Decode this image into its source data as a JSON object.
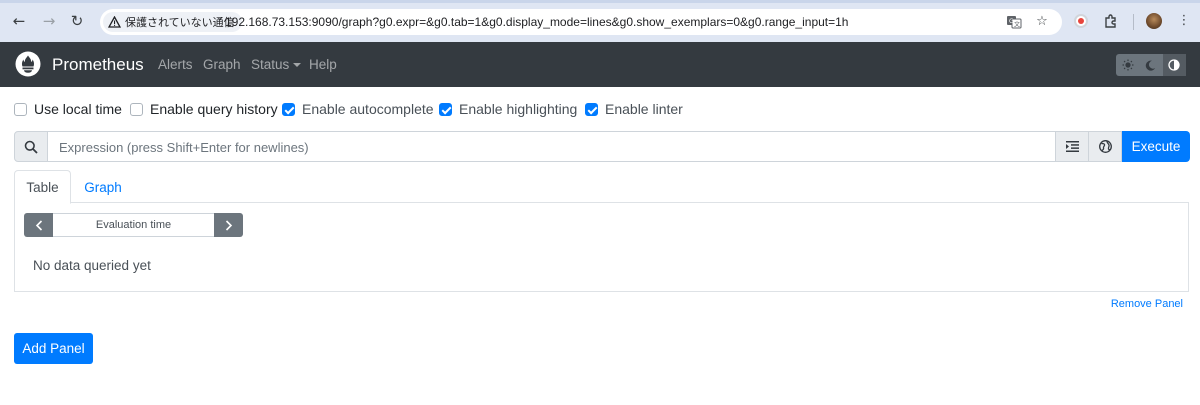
{
  "browser": {
    "security_label": "保護されていない通信",
    "url": "192.168.73.153:9090/graph?g0.expr=&g0.tab=1&g0.display_mode=lines&g0.show_exemplars=0&g0.range_input=1h"
  },
  "navbar": {
    "brand": "Prometheus",
    "links": [
      "Alerts",
      "Graph",
      "Status",
      "Help"
    ]
  },
  "options": [
    {
      "label": "Use local time",
      "checked": false
    },
    {
      "label": "Enable query history",
      "checked": false
    },
    {
      "label": "Enable autocomplete",
      "checked": true
    },
    {
      "label": "Enable highlighting",
      "checked": true
    },
    {
      "label": "Enable linter",
      "checked": true
    }
  ],
  "expression": {
    "placeholder": "Expression (press Shift+Enter for newlines)",
    "execute_label": "Execute"
  },
  "panel": {
    "tabs": [
      "Table",
      "Graph"
    ],
    "eval_time_placeholder": "Evaluation time",
    "empty_text": "No data queried yet",
    "remove_label": "Remove Panel"
  },
  "add_panel_label": "Add Panel",
  "colors": {
    "navbar": "#343a40",
    "primary": "#007bff",
    "secondary": "#6c757d"
  }
}
